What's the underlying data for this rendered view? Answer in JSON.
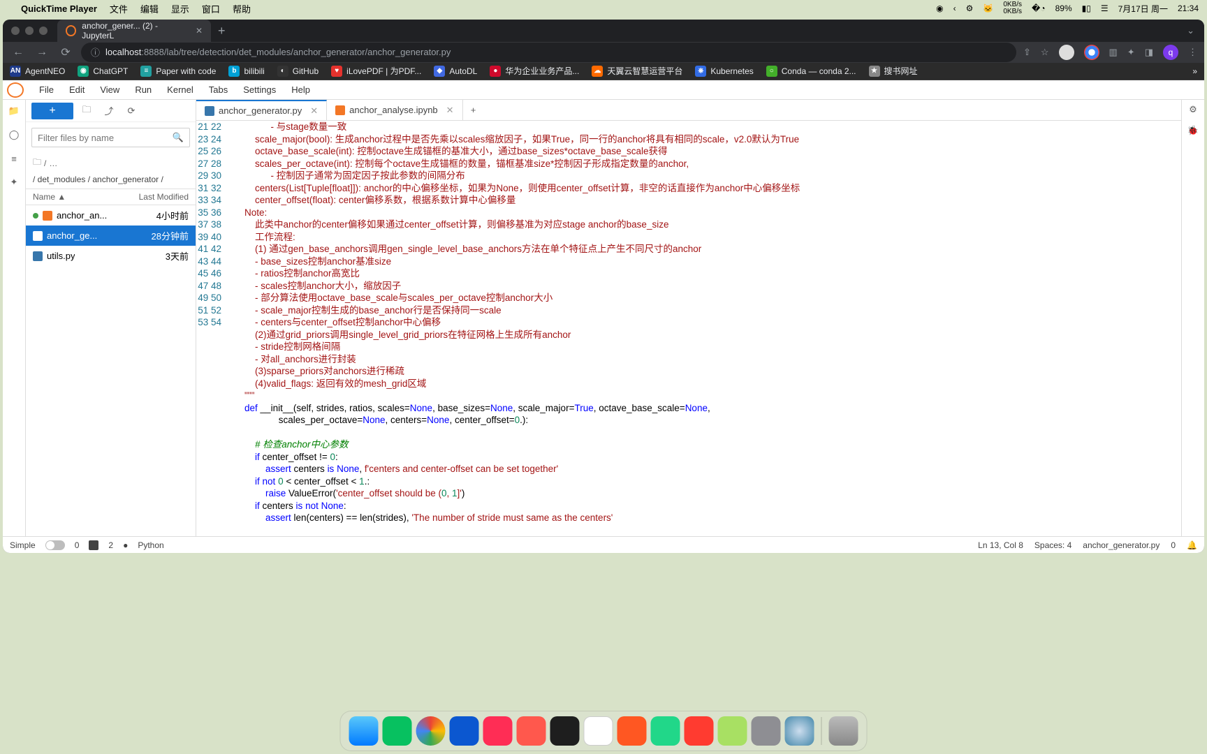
{
  "menubar": {
    "app": "QuickTime Player",
    "items": [
      "文件",
      "编辑",
      "显示",
      "窗口",
      "帮助"
    ],
    "net_up": "0KB/s",
    "net_dn": "0KB/s",
    "battery": "89%",
    "date": "7月17日 周一",
    "time": "21:34"
  },
  "browser": {
    "tab_title": "anchor_gener... (2) - JupyterL",
    "url_host": "localhost",
    "url_port": ":8888",
    "url_path": "/lab/tree/detection/det_modules/anchor_generator/anchor_generator.py",
    "bookmarks": [
      {
        "label": "AgentNEO",
        "bg": "#1e3a8a",
        "ico": "AN"
      },
      {
        "label": "ChatGPT",
        "bg": "#10a37f",
        "ico": "◉"
      },
      {
        "label": "Paper with code",
        "bg": "#21a0a0",
        "ico": "≡"
      },
      {
        "label": "bilibili",
        "bg": "#00a1d6",
        "ico": "b"
      },
      {
        "label": "GitHub",
        "bg": "#333",
        "ico": "◐"
      },
      {
        "label": "iLovePDF | 为PDF...",
        "bg": "#e5322d",
        "ico": "♥"
      },
      {
        "label": "AutoDL",
        "bg": "#4169e1",
        "ico": "◆"
      },
      {
        "label": "华为企业业务产品...",
        "bg": "#cf0a2c",
        "ico": "●"
      },
      {
        "label": "天翼云智慧运营平台",
        "bg": "#ff6a00",
        "ico": "☁"
      },
      {
        "label": "Kubernetes",
        "bg": "#326ce5",
        "ico": "⎈"
      },
      {
        "label": "Conda — conda 2...",
        "bg": "#43b02a",
        "ico": "○"
      },
      {
        "label": "搜书网址",
        "bg": "#888",
        "ico": "★"
      }
    ],
    "bm_more": "»"
  },
  "jlab": {
    "menus": [
      "File",
      "Edit",
      "View",
      "Run",
      "Kernel",
      "Tabs",
      "Settings",
      "Help"
    ],
    "filter_placeholder": "Filter files by name",
    "crumb_dots": "…",
    "path": "/ det_modules / anchor_generator /",
    "col_name": "Name",
    "col_mod": "Last Modified",
    "files": [
      {
        "name": "anchor_an...",
        "mod": "4小时前",
        "kind": "nb",
        "running": true
      },
      {
        "name": "anchor_ge...",
        "mod": "28分钟前",
        "kind": "py",
        "selected": true
      },
      {
        "name": "utils.py",
        "mod": "3天前",
        "kind": "py"
      }
    ],
    "tabs": [
      {
        "label": "anchor_generator.py",
        "ico": "py",
        "active": true
      },
      {
        "label": "anchor_analyse.ipynb",
        "ico": "nb",
        "active": false
      }
    ],
    "status": {
      "mode": "Simple",
      "zero": "0",
      "term": "2",
      "kernel_dot": "●",
      "lang": "Python",
      "lncol": "Ln 13, Col 8",
      "spaces": "Spaces: 4",
      "fname": "anchor_generator.py",
      "right_zero": "0"
    }
  },
  "code": {
    "first_line": 21,
    "lines": [
      "              - 与stage数量一致",
      "        scale_major(bool): 生成anchor过程中是否先乘以scales缩放因子，如果True，同一行的anchor将具有相同的scale，v2.0默认为True",
      "        octave_base_scale(int): 控制octave生成锚框的基准大小，通过base_sizes*octave_base_scale获得",
      "        scales_per_octave(int): 控制每个octave生成锚框的数量，锚框基准size*控制因子形成指定数量的anchor,",
      "              - 控制因子通常为固定因子按此参数的间隔分布",
      "        centers(List[Tuple[float]]): anchor的中心偏移坐标，如果为None，则使用center_offset计算，非空的话直接作为anchor中心偏移坐标",
      "        center_offset(float): center偏移系数，根据系数计算中心偏移量",
      "    Note:",
      "        此类中anchor的center偏移如果通过center_offset计算，则偏移基准为对应stage anchor的base_size",
      "        工作流程:",
      "        (1) 通过gen_base_anchors调用gen_single_level_base_anchors方法在单个特征点上产生不同尺寸的anchor",
      "        - base_sizes控制anchor基准size",
      "        - ratios控制anchor高宽比",
      "        - scales控制anchor大小，缩放因子",
      "        - 部分算法使用octave_base_scale与scales_per_octave控制anchor大小",
      "        - scale_major控制生成的base_anchor行是否保持同一scale",
      "        - centers与center_offset控制anchor中心偏移",
      "        (2)通过grid_priors调用single_level_grid_priors在特征网格上生成所有anchor",
      "        - stride控制网格间隔",
      "        - 对all_anchors进行封装",
      "        (3)sparse_priors对anchors进行稀疏",
      "        (4)valid_flags: 返回有效的mesh_grid区域",
      "    \"\"\"",
      "    def __init__(self, strides, ratios, scales=None, base_sizes=None, scale_major=True, octave_base_scale=None,",
      "                 scales_per_octave=None, centers=None, center_offset=0.):",
      "",
      "        # 检查anchor中心参数",
      "        if center_offset != 0:",
      "            assert centers is None, f'centers and center-offset can be set together'",
      "        if not 0 < center_offset < 1.:",
      "            raise ValueError('center_offset should be (0, 1]')",
      "        if centers is not None:",
      "            assert len(centers) == len(strides), 'The number of stride must same as the centers'",
      ""
    ]
  }
}
